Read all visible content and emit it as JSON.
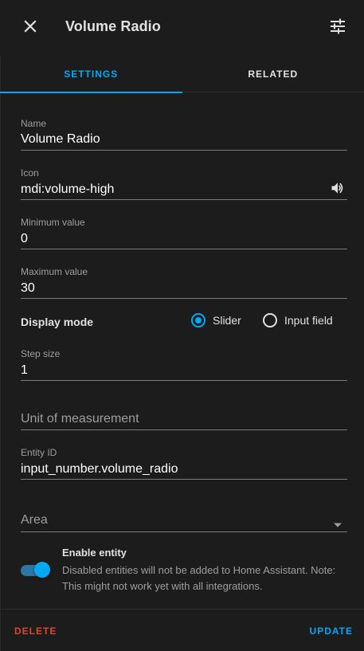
{
  "header": {
    "title": "Volume Radio",
    "close_icon": "close-icon",
    "settings_icon": "tune-icon"
  },
  "tabs": [
    {
      "label": "SETTINGS",
      "active": true
    },
    {
      "label": "RELATED",
      "active": false
    }
  ],
  "form": {
    "name": {
      "label": "Name",
      "value": "Volume Radio"
    },
    "icon": {
      "label": "Icon",
      "value": "mdi:volume-high",
      "preview_icon": "volume-high-icon"
    },
    "minimum": {
      "label": "Minimum value",
      "value": "0"
    },
    "maximum": {
      "label": "Maximum value",
      "value": "30"
    },
    "display_mode": {
      "label": "Display mode",
      "options": [
        {
          "label": "Slider",
          "selected": true
        },
        {
          "label": "Input field",
          "selected": false
        }
      ]
    },
    "step": {
      "label": "Step size",
      "value": "1"
    },
    "unit": {
      "placeholder": "Unit of measurement",
      "value": ""
    },
    "entity_id": {
      "label": "Entity ID",
      "value": "input_number.volume_radio"
    },
    "area": {
      "placeholder": "Area",
      "value": ""
    }
  },
  "enable_entity": {
    "title": "Enable entity",
    "description": "Disabled entities will not be added to Home Assistant. Note: This might not work yet with all integrations.",
    "enabled": true
  },
  "footer": {
    "delete_label": "DELETE",
    "update_label": "UPDATE"
  },
  "colors": {
    "accent": "#03a9f4",
    "danger": "#db4437",
    "background": "#1c1c1c"
  }
}
